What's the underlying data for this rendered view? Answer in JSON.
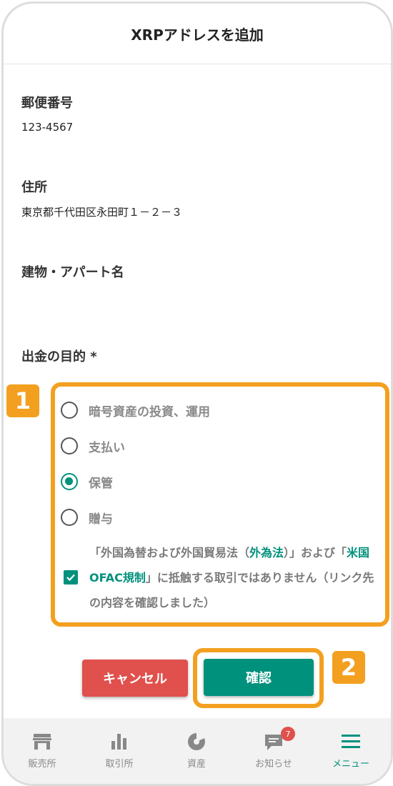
{
  "header": {
    "title": "XRPアドレスを追加"
  },
  "form": {
    "postal": {
      "label": "郵便番号",
      "value": "123-4567"
    },
    "address": {
      "label": "住所",
      "value": "東京都千代田区永田町１－２－３"
    },
    "building": {
      "label": "建物・アパート名",
      "value": ""
    },
    "purpose": {
      "label": "出金の目的 *",
      "options": [
        "暗号資産の投資、運用",
        "支払い",
        "保管",
        "贈与"
      ],
      "selected": "保管"
    },
    "consent": {
      "t1": "「外国為替および外国貿易法（",
      "l1": "外為法",
      "t2": "）」および「",
      "l2": "米国OFAC規制",
      "t3": "」に抵触する取引ではありません（リンク先の内容を確認しました）",
      "checked": true
    }
  },
  "annotations": {
    "badge1": "1",
    "badge2": "2"
  },
  "buttons": {
    "cancel": "キャンセル",
    "confirm": "確認"
  },
  "tabbar": {
    "items": [
      {
        "label": "販売所",
        "icon": "store-icon"
      },
      {
        "label": "取引所",
        "icon": "bar-chart-icon"
      },
      {
        "label": "資産",
        "icon": "pie-chart-icon"
      },
      {
        "label": "お知らせ",
        "icon": "chat-icon",
        "badge": "7"
      },
      {
        "label": "メニュー",
        "icon": "menu-icon",
        "active": true
      }
    ]
  },
  "colors": {
    "accent": "#00917c",
    "danger": "#e0504d",
    "highlight": "#f3a020"
  }
}
